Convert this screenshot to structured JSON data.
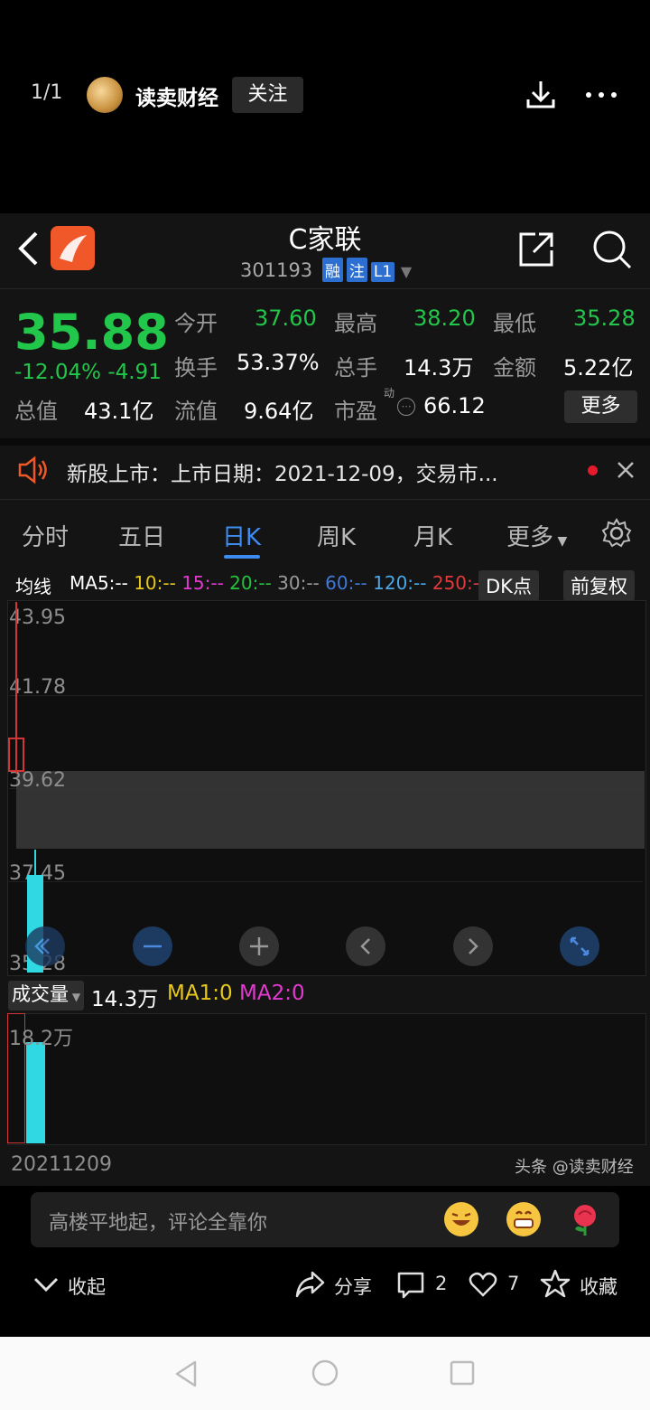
{
  "viewer": {
    "counter": "1/1",
    "author": "读卖财经",
    "follow_label": "关注"
  },
  "stock": {
    "name": "C家联",
    "code": "301193",
    "tags": [
      "融",
      "注",
      "L1"
    ],
    "price": "35.88",
    "change_pct": "-12.04%",
    "change_amt": "-4.91"
  },
  "quote": [
    {
      "label": "今开",
      "value": "37.60"
    },
    {
      "label": "最高",
      "value": "38.20"
    },
    {
      "label": "最低",
      "value": "35.28"
    },
    {
      "label": "换手",
      "value": "53.37%"
    },
    {
      "label": "总手",
      "value": "14.3万"
    },
    {
      "label": "金额",
      "value": "5.22亿"
    },
    {
      "label": "总值",
      "value": "43.1亿"
    },
    {
      "label": "流值",
      "value": "9.64亿"
    },
    {
      "label": "市盈",
      "value": "66.12",
      "sup": "动"
    }
  ],
  "more_label": "更多",
  "notice": "新股上市：上市日期：2021-12-09，交易市...",
  "tabs": [
    "分时",
    "五日",
    "日K",
    "周K",
    "月K",
    "更多"
  ],
  "ma": {
    "title": "均线",
    "items": [
      "MA5:--",
      "10:--",
      "15:--",
      "20:--",
      "30:--",
      "60:--",
      "120:--",
      "250:--"
    ],
    "colors": [
      "#ffffff",
      "#e8c81a",
      "#e23ad0",
      "#25c13f",
      "#9a9a9a",
      "#3f7ad9",
      "#4aa8e8",
      "#e23a3a"
    ],
    "dk_label": "DK点",
    "adj_label": "前复权"
  },
  "price_axis": [
    "43.95",
    "41.78",
    "39.62",
    "37.45",
    "35.28"
  ],
  "volume": {
    "label": "成交量",
    "value": "14.3万",
    "ma1": "MA1:0",
    "ma2": "MA2:0",
    "max_label": "18.2万",
    "date": "20211209"
  },
  "watermark": "头条 @读卖财经",
  "comment_placeholder": "高楼平地起，评论全靠你",
  "bottom": {
    "collapse": "收起",
    "share": "分享",
    "comments": "2",
    "likes": "7",
    "favorite": "收藏"
  }
}
